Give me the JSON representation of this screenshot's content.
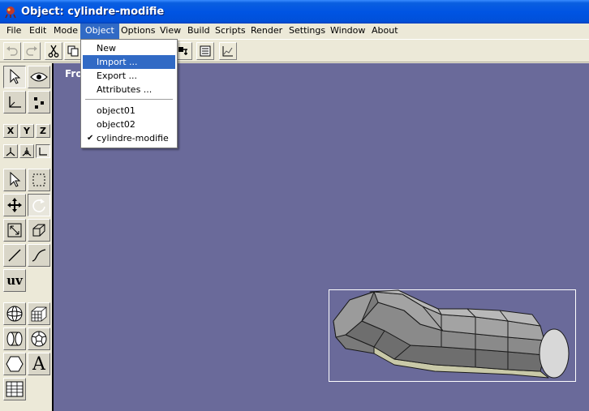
{
  "window": {
    "title": "Object: cylindre-modifie"
  },
  "menubar": {
    "items": [
      {
        "label": "File"
      },
      {
        "label": "Edit"
      },
      {
        "label": "Mode"
      },
      {
        "label": "Object"
      },
      {
        "label": "Options"
      },
      {
        "label": "View"
      },
      {
        "label": "Build"
      },
      {
        "label": "Scripts"
      },
      {
        "label": "Render"
      },
      {
        "label": "Settings"
      },
      {
        "label": "Window"
      },
      {
        "label": "About"
      }
    ],
    "active": "Object"
  },
  "object_menu": {
    "items": [
      {
        "label": "New"
      },
      {
        "label": "Import ...",
        "highlighted": true
      },
      {
        "label": "Export ..."
      },
      {
        "label": "Attributes ..."
      }
    ],
    "objects": [
      {
        "label": "object01",
        "checked": false
      },
      {
        "label": "object02",
        "checked": false
      },
      {
        "label": "cylindre-modifie",
        "checked": true
      }
    ]
  },
  "palette": {
    "axis_x": "X",
    "axis_y": "Y",
    "axis_z": "Z",
    "uv_label": "uv",
    "text_tool": "A"
  },
  "viewport": {
    "label": "Fro",
    "background": "#6a6a9a"
  },
  "colors": {
    "title_bar": "#0054e3",
    "menu_highlight": "#316ac5",
    "mesh_face": "#8e8e8e",
    "mesh_edge": "#1a1a1a"
  },
  "icons": {
    "toolbar": [
      "undo-icon",
      "redo-icon",
      "cut-icon",
      "copy-icon",
      "node-icon",
      "list-icon",
      "graph-icon"
    ],
    "palette": [
      "select-arrow-icon",
      "eye-icon",
      "axes-icon",
      "points-icon",
      "pointer-icon",
      "marquee-icon",
      "move-icon",
      "rotate-icon",
      "scale-icon",
      "box-icon",
      "line-icon",
      "curve-icon",
      "sphere-icon",
      "grid-cube-icon",
      "cylinder-icon",
      "polyhedron-icon",
      "hexagon-icon",
      "table-icon"
    ]
  }
}
